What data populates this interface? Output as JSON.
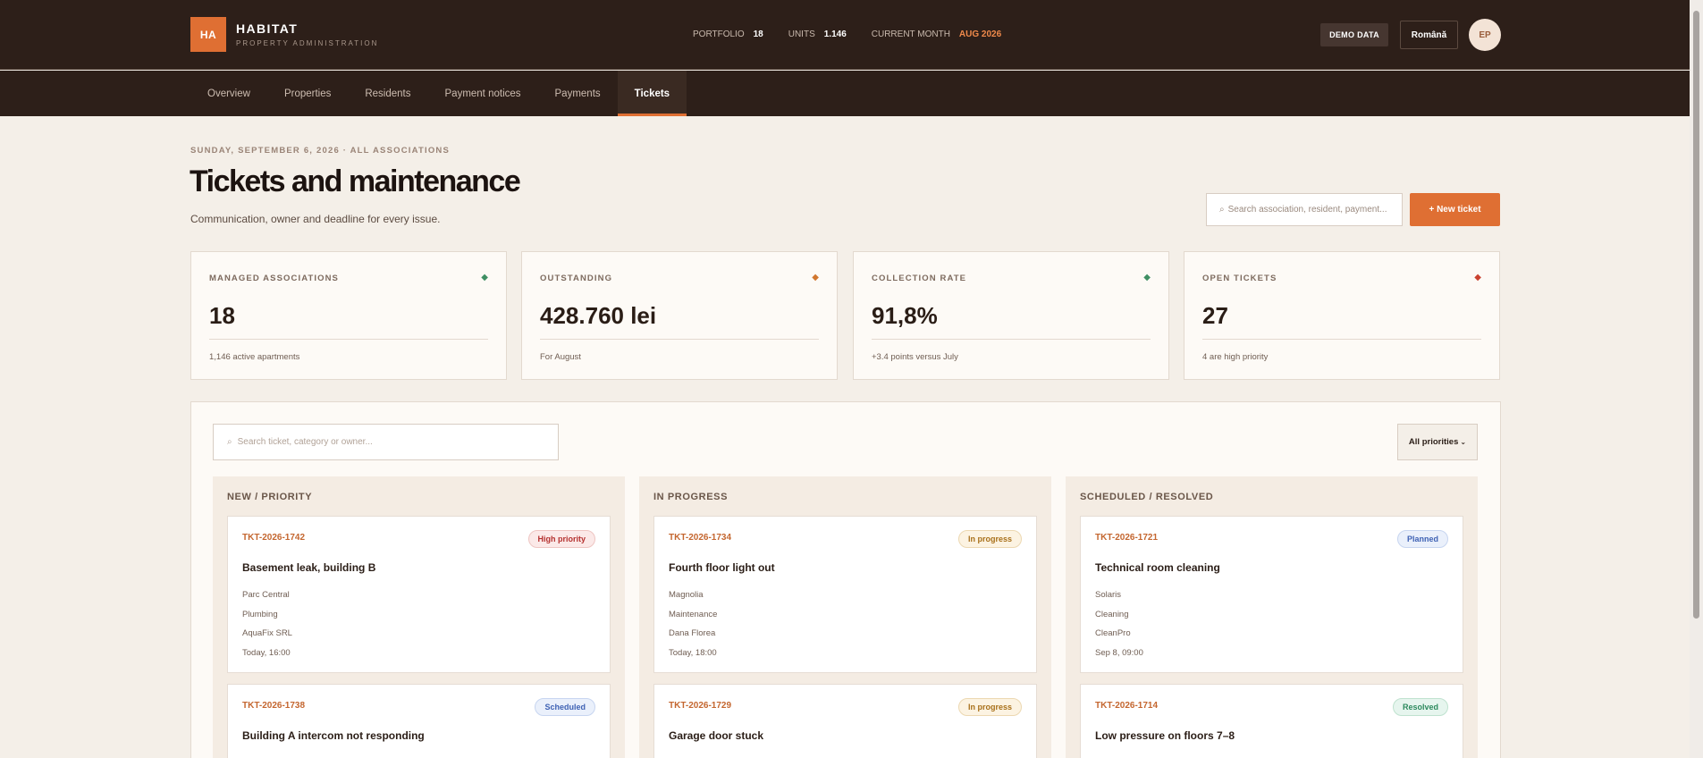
{
  "brand": {
    "logo": "HA",
    "name": "HABITAT",
    "tagline": "PROPERTY ADMINISTRATION"
  },
  "header_stats": [
    {
      "label": "PORTFOLIO",
      "value": "18"
    },
    {
      "label": "UNITS",
      "value": "1.146"
    },
    {
      "label": "CURRENT MONTH",
      "value": "AUG 2026"
    }
  ],
  "header_actions": {
    "demo": "DEMO DATA",
    "language": "Română",
    "avatar": "EP"
  },
  "nav": [
    "Overview",
    "Properties",
    "Residents",
    "Payment notices",
    "Payments",
    "Tickets"
  ],
  "nav_active": "Tickets",
  "page": {
    "dateline": "SUNDAY, SEPTEMBER 6, 2026 · ALL ASSOCIATIONS",
    "title": "Tickets and maintenance",
    "subtitle": "Communication, owner and deadline for every issue.",
    "search_placeholder": "Search association, resident, payment...",
    "new_ticket": "+ New ticket"
  },
  "kpis": [
    {
      "label": "MANAGED ASSOCIATIONS",
      "value": "18",
      "note": "1,146 active apartments",
      "color": "#3f8f63"
    },
    {
      "label": "OUTSTANDING",
      "value": "428.760 lei",
      "note": "For August",
      "color": "#d1772f"
    },
    {
      "label": "COLLECTION RATE",
      "value": "91,8%",
      "note": "+3.4 points versus July",
      "color": "#3f8f63"
    },
    {
      "label": "OPEN TICKETS",
      "value": "27",
      "note": "4 are high priority",
      "color": "#c9412f"
    }
  ],
  "filters": {
    "search_placeholder": "Search ticket, category or owner...",
    "priority": "All priorities"
  },
  "columns": [
    {
      "title": "NEW / PRIORITY",
      "cards": [
        {
          "id": "TKT-2026-1742",
          "badge": "High priority",
          "badge_kind": "high",
          "title": "Basement leak, building B",
          "meta": [
            "Parc Central",
            "Plumbing",
            "AquaFix SRL",
            "Today, 16:00"
          ]
        },
        {
          "id": "TKT-2026-1738",
          "badge": "Scheduled",
          "badge_kind": "sched",
          "title": "Building A intercom not responding",
          "meta": []
        }
      ]
    },
    {
      "title": "IN PROGRESS",
      "cards": [
        {
          "id": "TKT-2026-1734",
          "badge": "In progress",
          "badge_kind": "prog",
          "title": "Fourth floor light out",
          "meta": [
            "Magnolia",
            "Maintenance",
            "Dana Florea",
            "Today, 18:00"
          ]
        },
        {
          "id": "TKT-2026-1729",
          "badge": "In progress",
          "badge_kind": "prog",
          "title": "Garage door stuck",
          "meta": []
        }
      ]
    },
    {
      "title": "SCHEDULED / RESOLVED",
      "cards": [
        {
          "id": "TKT-2026-1721",
          "badge": "Planned",
          "badge_kind": "plan",
          "title": "Technical room cleaning",
          "meta": [
            "Solaris",
            "Cleaning",
            "CleanPro",
            "Sep 8, 09:00"
          ]
        },
        {
          "id": "TKT-2026-1714",
          "badge": "Resolved",
          "badge_kind": "res",
          "title": "Low pressure on floors 7–8",
          "meta": []
        }
      ]
    }
  ]
}
